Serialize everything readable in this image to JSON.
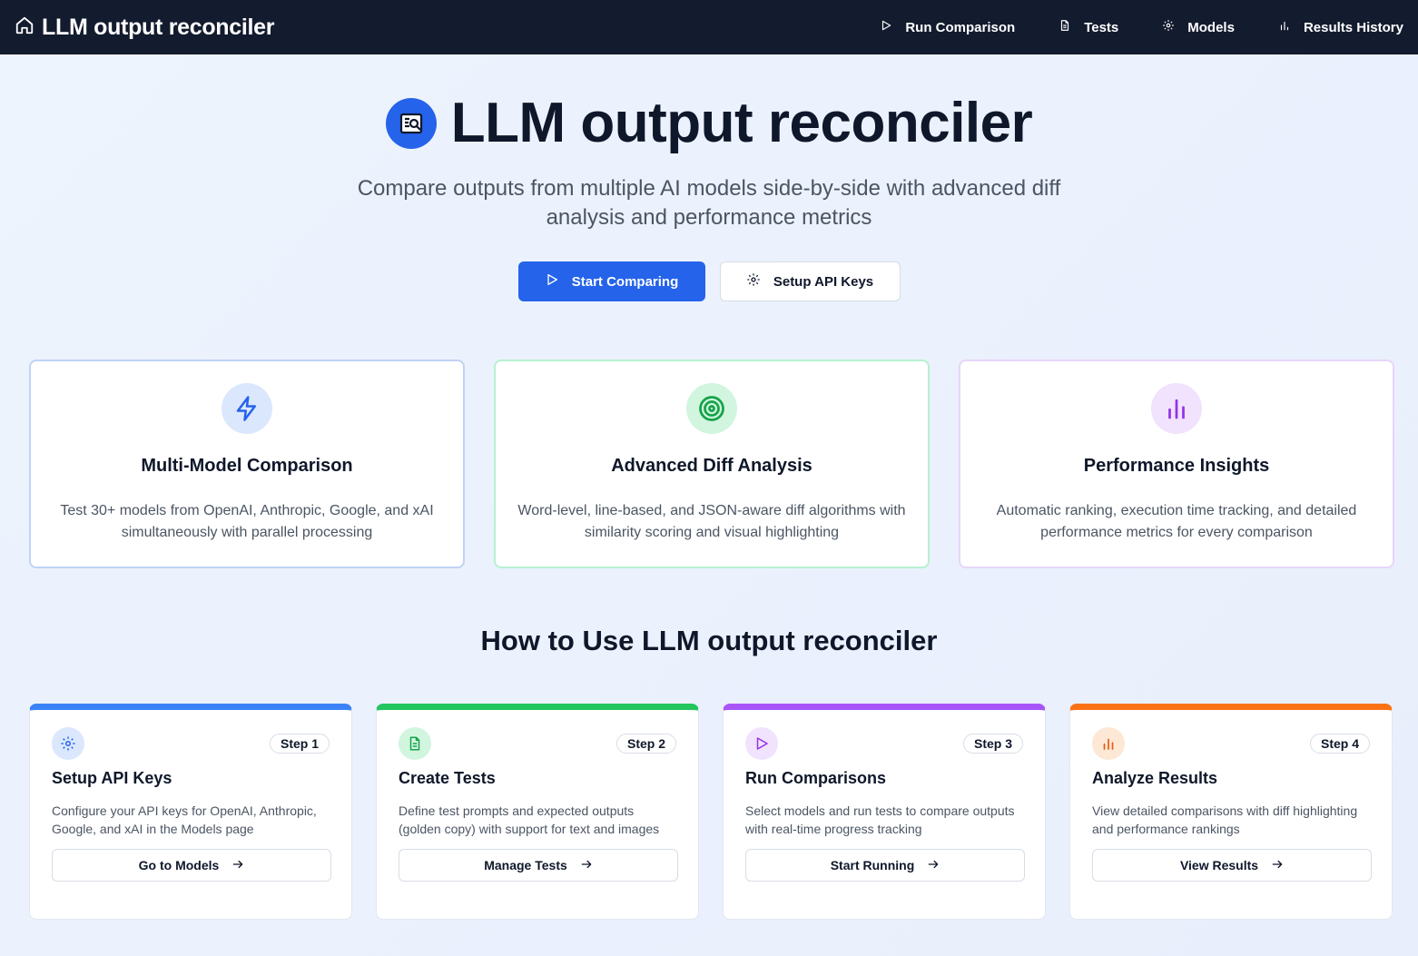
{
  "app": {
    "title": "LLM output reconciler",
    "home_icon": "home-icon"
  },
  "nav": [
    {
      "label": "Run Comparison",
      "icon": "play-icon"
    },
    {
      "label": "Tests",
      "icon": "document-icon"
    },
    {
      "label": "Models",
      "icon": "gear-icon"
    },
    {
      "label": "Results History",
      "icon": "bar-chart-icon"
    }
  ],
  "hero": {
    "title": "LLM output reconciler",
    "subtitle": "Compare outputs from multiple AI models side-by-side with advanced diff analysis and performance metrics",
    "primary_button": "Start Comparing",
    "secondary_button": "Setup API Keys"
  },
  "features": [
    {
      "title": "Multi-Model Comparison",
      "desc": "Test 30+ models from OpenAI, Anthropic, Google, and xAI simultaneously with parallel processing",
      "icon": "lightning-icon",
      "color": "#2563eb"
    },
    {
      "title": "Advanced Diff Analysis",
      "desc": "Word-level, line-based, and JSON-aware diff algorithms with similarity scoring and visual highlighting",
      "icon": "target-icon",
      "color": "#16a34a"
    },
    {
      "title": "Performance Insights",
      "desc": "Automatic ranking, execution time tracking, and detailed performance metrics for every comparison",
      "icon": "bar-chart-icon",
      "color": "#9333ea"
    }
  ],
  "howto": {
    "title": "How to Use LLM output reconciler",
    "steps": [
      {
        "badge": "Step 1",
        "title": "Setup API Keys",
        "desc": "Configure your API keys for OpenAI, Anthropic, Google, and xAI in the Models page",
        "button": "Go to Models",
        "icon": "gear-icon",
        "color": "#3b82f6"
      },
      {
        "badge": "Step 2",
        "title": "Create Tests",
        "desc": "Define test prompts and expected outputs (golden copy) with support for text and images",
        "button": "Manage Tests",
        "icon": "document-icon",
        "color": "#22c55e"
      },
      {
        "badge": "Step 3",
        "title": "Run Comparisons",
        "desc": "Select models and run tests to compare outputs with real-time progress tracking",
        "button": "Start Running",
        "icon": "play-icon",
        "color": "#a855f7"
      },
      {
        "badge": "Step 4",
        "title": "Analyze Results",
        "desc": "View detailed comparisons with diff highlighting and performance rankings",
        "button": "View Results",
        "icon": "bar-chart-icon",
        "color": "#f97316"
      }
    ]
  }
}
